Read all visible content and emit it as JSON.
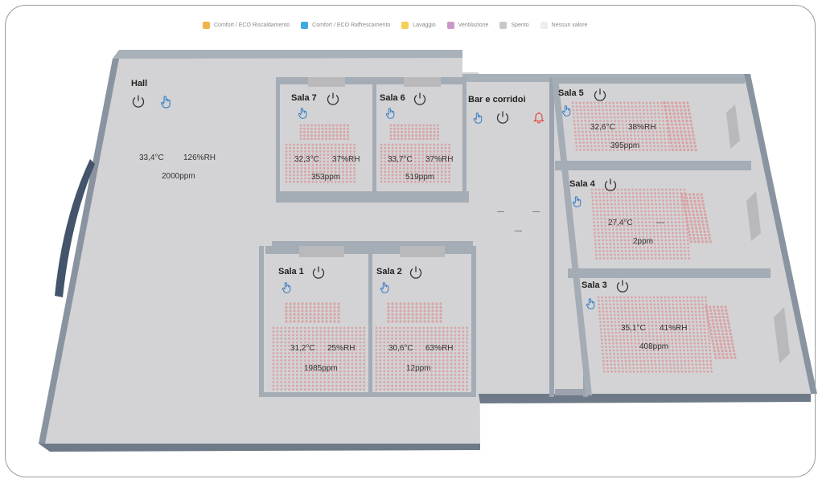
{
  "legend": [
    {
      "label": "Comfort / ECO Riscaldamento",
      "color": "#f0b448"
    },
    {
      "label": "Comfort / ECO Raffrescamento",
      "color": "#3fa9e0"
    },
    {
      "label": "Lavaggio",
      "color": "#f3cf55"
    },
    {
      "label": "Ventilazione",
      "color": "#c99ac9"
    },
    {
      "label": "Spento",
      "color": "#c8c8c8"
    },
    {
      "label": "Nessun valore",
      "color": "#eeeeee"
    }
  ],
  "colors": {
    "floor": "#d3d3d5",
    "wall": "#8f9aa7",
    "wall_dark": "#44546a",
    "seat": "#d9989a",
    "icon_blue": "#3b7fc4",
    "alarm_red": "#e53935"
  },
  "rooms": {
    "hall": {
      "name": "Hall",
      "temp": "33,4°C",
      "humidity": "126%RH",
      "co2": "2000ppm"
    },
    "sala7": {
      "name": "Sala 7",
      "temp": "32,3°C",
      "humidity": "37%RH",
      "co2": "353ppm"
    },
    "sala6": {
      "name": "Sala 6",
      "temp": "33,7°C",
      "humidity": "37%RH",
      "co2": "519ppm"
    },
    "bar": {
      "name": "Bar e corridoi",
      "temp": "---",
      "humidity": "---",
      "co2": "---"
    },
    "sala5": {
      "name": "Sala 5",
      "temp": "32,6°C",
      "humidity": "38%RH",
      "co2": "395ppm"
    },
    "sala4": {
      "name": "Sala 4",
      "temp": "27,4°C",
      "humidity": "---",
      "co2": "2ppm"
    },
    "sala1": {
      "name": "Sala 1",
      "temp": "31,2°C",
      "humidity": "25%RH",
      "co2": "1985ppm"
    },
    "sala2": {
      "name": "Sala 2",
      "temp": "30,6°C",
      "humidity": "63%RH",
      "co2": "12ppm"
    },
    "sala3": {
      "name": "Sala 3",
      "temp": "35,1°C",
      "humidity": "41%RH",
      "co2": "408ppm"
    }
  },
  "icons": {
    "power": "power-icon",
    "manual": "hand-pointer-icon",
    "alarm": "bell-icon"
  }
}
